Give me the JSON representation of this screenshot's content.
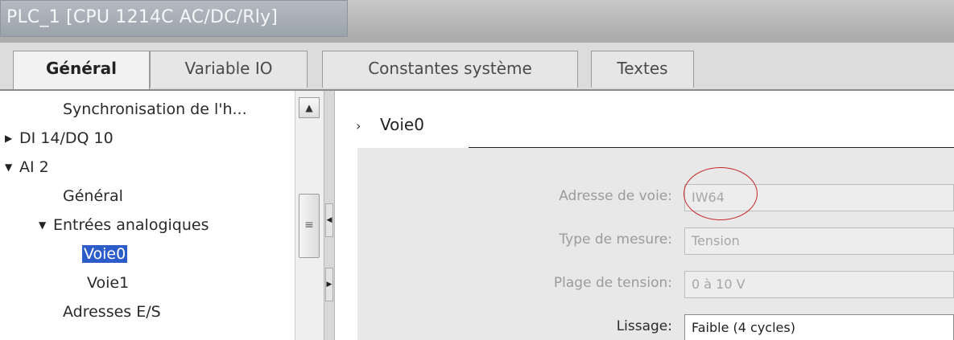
{
  "window": {
    "title": "PLC_1 [CPU 1214C AC/DC/Rly]"
  },
  "tabs": [
    {
      "label": "Général",
      "active": true
    },
    {
      "label": "Variable IO",
      "active": false
    },
    {
      "label": "Constantes système",
      "active": false
    },
    {
      "label": "Textes",
      "active": false
    }
  ],
  "tree": {
    "items": [
      {
        "label": "Synchronisation de l'h...",
        "expander": "none"
      },
      {
        "label": "DI 14/DQ 10",
        "expander": "collapsed"
      },
      {
        "label": "AI 2",
        "expander": "expanded"
      },
      {
        "label": "Général",
        "expander": "none"
      },
      {
        "label": "Entrées analogiques",
        "expander": "expanded"
      },
      {
        "label": "Voie0",
        "expander": "none",
        "selected": true
      },
      {
        "label": "Voie1",
        "expander": "none"
      },
      {
        "label": "Adresses E/S",
        "expander": "none"
      }
    ],
    "arrow_collapsed": "▶",
    "arrow_expanded": "▼",
    "scroll_up_glyph": "▲",
    "scroll_grip_glyph": "≡"
  },
  "section": {
    "chevron": "›",
    "title": "Voie0"
  },
  "fields": [
    {
      "label": "Adresse de voie:",
      "value": "IW64",
      "enabled": false
    },
    {
      "label": "Type de mesure:",
      "value": "Tension",
      "enabled": false
    },
    {
      "label": "Plage de tension:",
      "value": "0 à 10 V",
      "enabled": false
    },
    {
      "label": "Lissage:",
      "value": "Faible (4 cycles)",
      "enabled": true
    }
  ],
  "colors": {
    "selection": "#2b5cc9",
    "annotation_circle": "#c62828"
  }
}
